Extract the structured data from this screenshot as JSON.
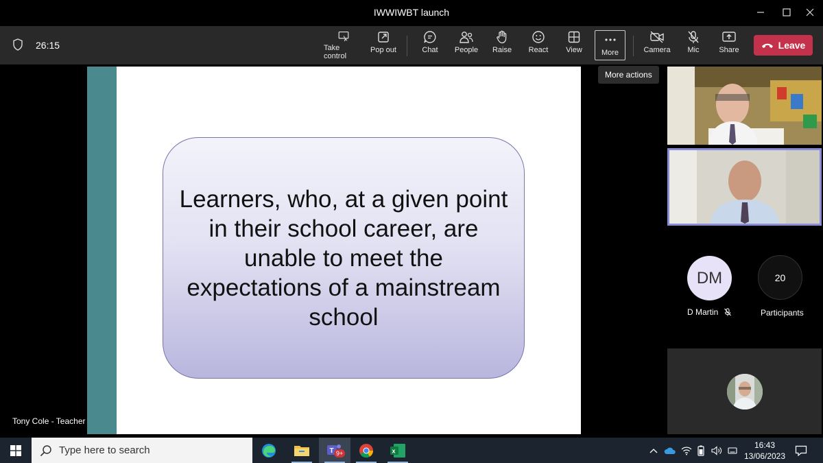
{
  "window": {
    "title": "IWWIWBT launch"
  },
  "toolbar": {
    "timer": "26:15",
    "take_control": "Take control",
    "pop_out": "Pop out",
    "chat": "Chat",
    "people": "People",
    "raise": "Raise",
    "react": "React",
    "view": "View",
    "more": "More",
    "camera": "Camera",
    "mic": "Mic",
    "share": "Share",
    "leave": "Leave",
    "more_tooltip": "More actions"
  },
  "stage": {
    "presenter": "Tony Cole - Teacher",
    "slide_text": "Learners, who, at a given point in their school career, are unable to meet the expectations of a mainstream school"
  },
  "participants": {
    "dm_initials": "DM",
    "dm_name": "D Martin",
    "count": "20",
    "count_label": "Participants"
  },
  "taskbar": {
    "search_placeholder": "Type here to search",
    "teams_badge": "9+",
    "time": "16:43",
    "date": "13/06/2023"
  },
  "colors": {
    "leave": "#c4314b",
    "toolbar": "#292929",
    "slide_accent": "#4a8a8f",
    "active_speaker_border": "#8b8cd8"
  }
}
